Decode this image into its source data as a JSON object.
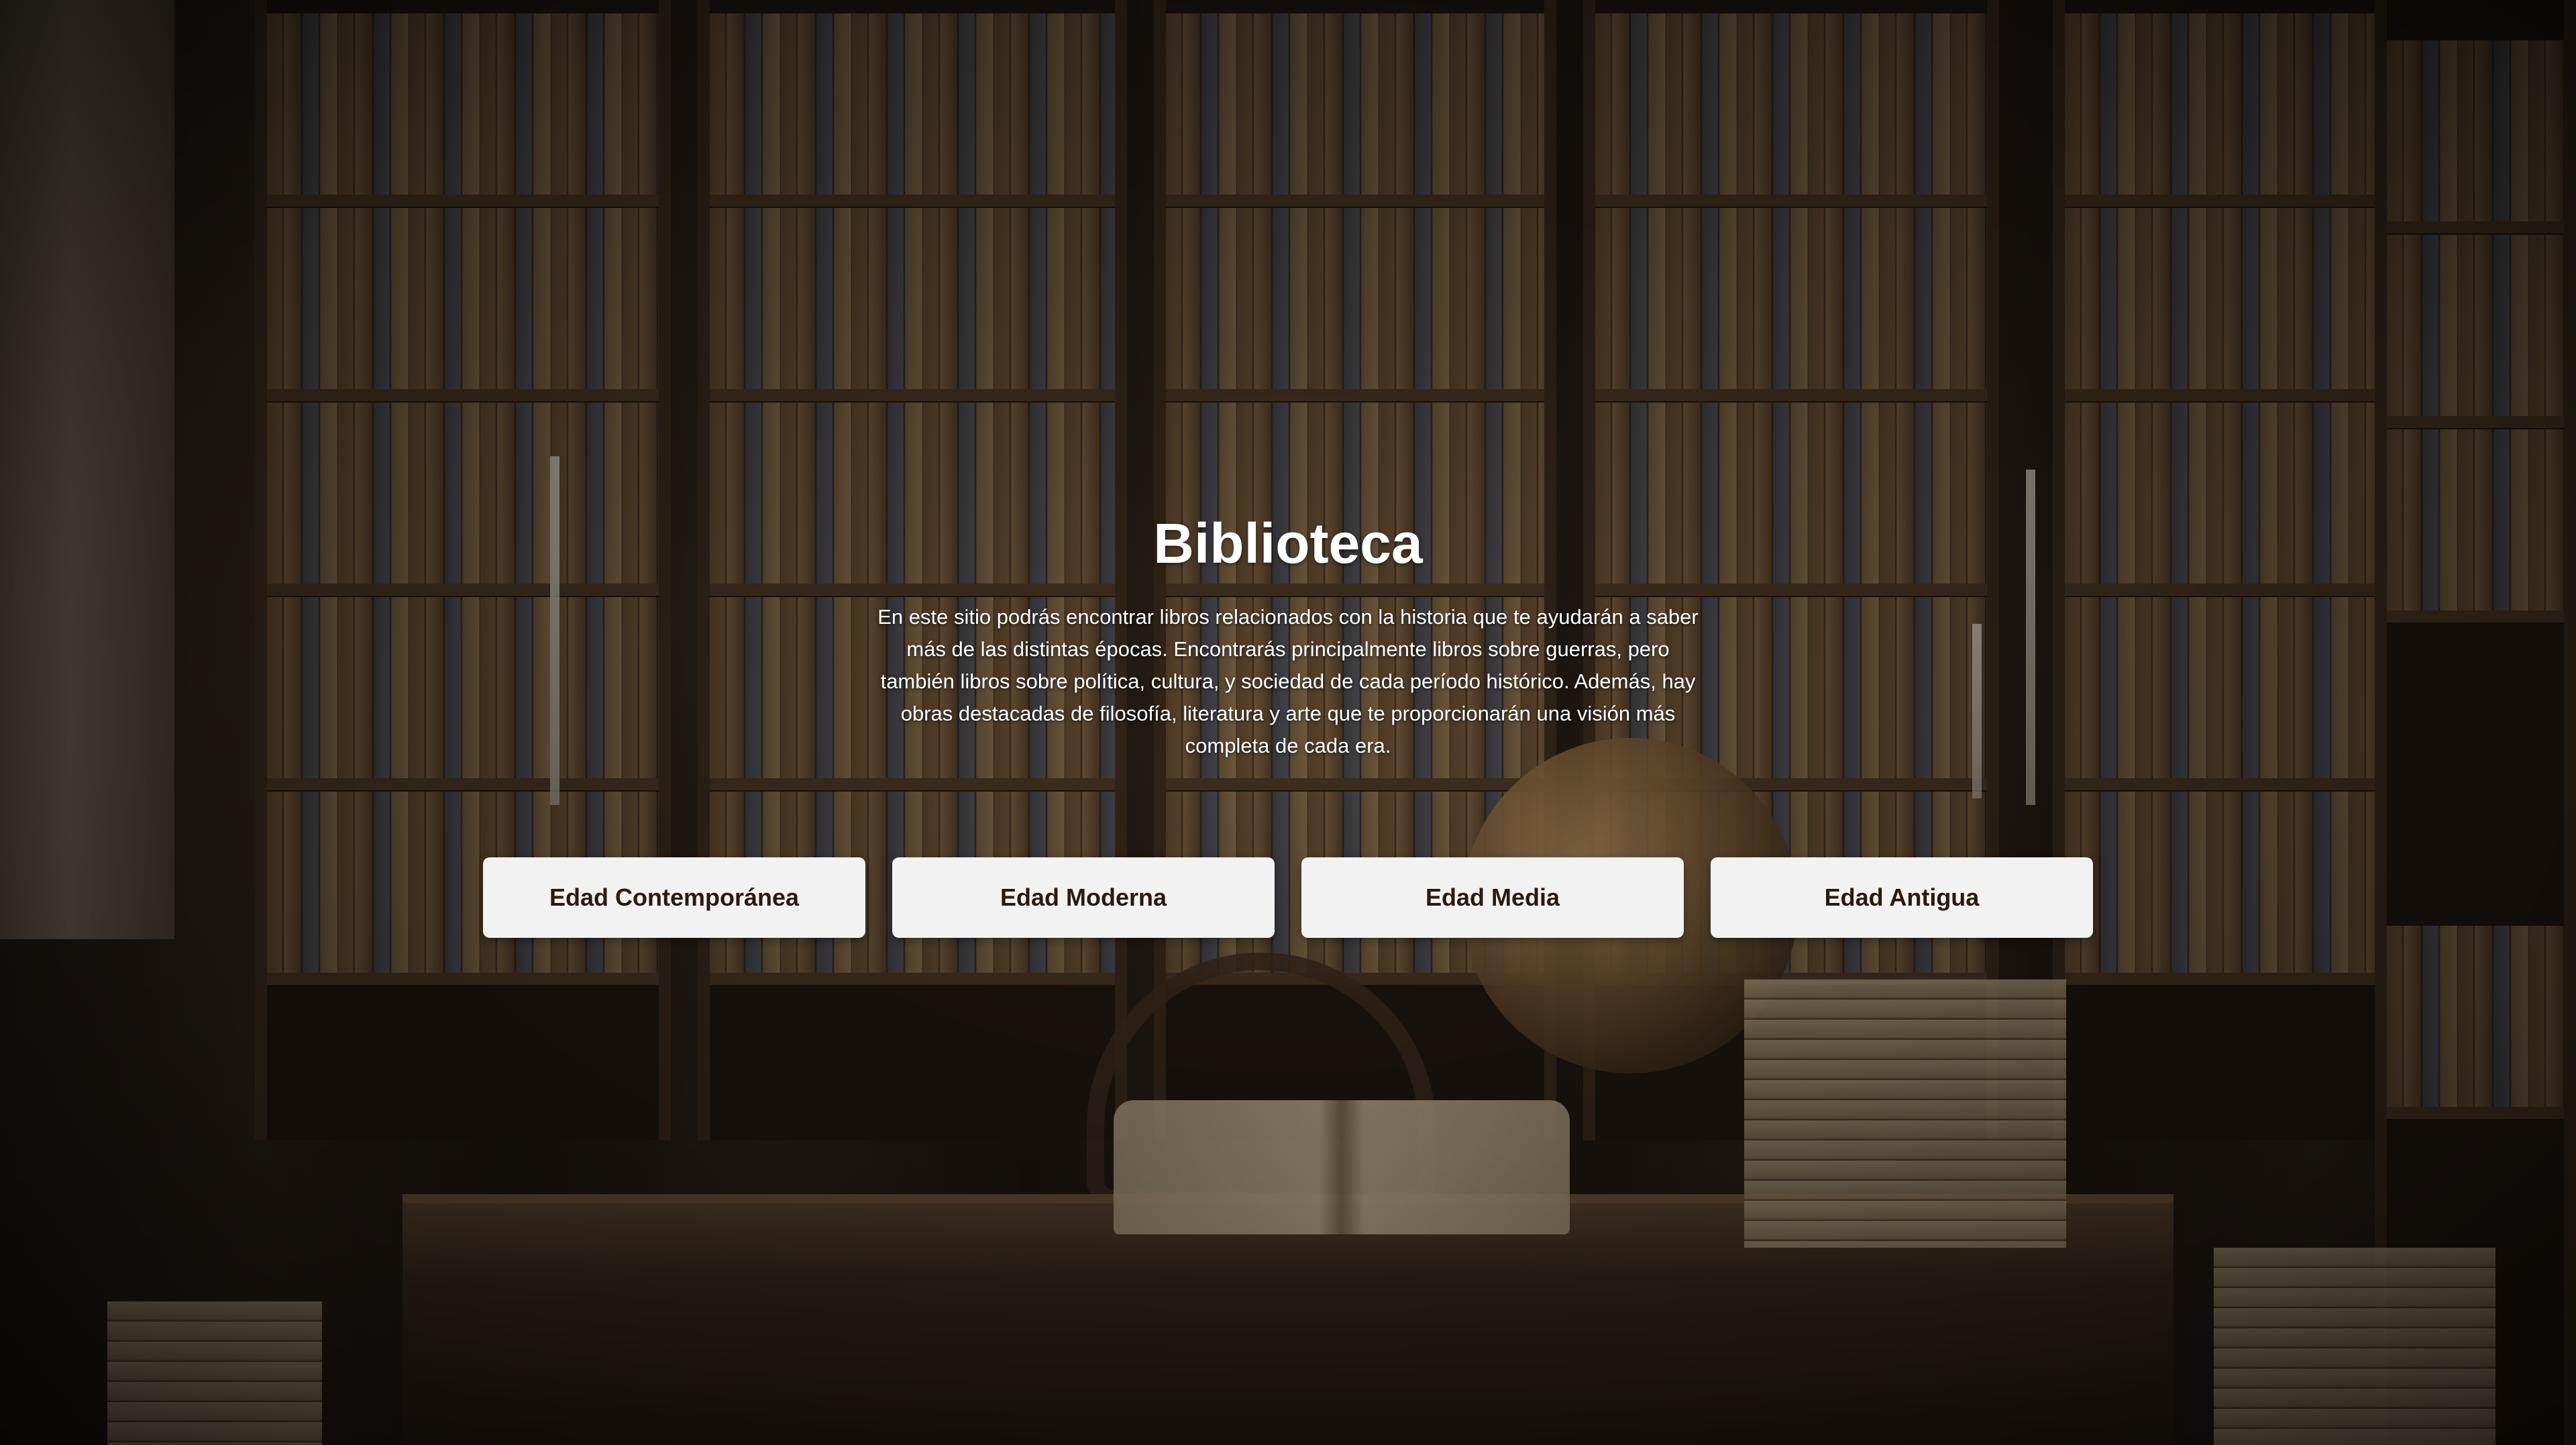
{
  "page": {
    "title": "Biblioteca",
    "description": "En este sitio podrás encontrar libros relacionados con la historia que te ayudarán a saber más de las distintas épocas. Encontrarás principalmente libros sobre guerras, pero también libros sobre política, cultura, y sociedad de cada período histórico. Además, hay obras destacadas de filosofía, literatura y arte que te proporcionarán una visión más completa de cada era.",
    "background_image": "library-bookshelves-scene"
  },
  "buttons": [
    {
      "label": "Edad Contemporánea"
    },
    {
      "label": "Edad Moderna"
    },
    {
      "label": "Edad Media"
    },
    {
      "label": "Edad Antigua"
    }
  ],
  "colors": {
    "button_background": "#f2f2f2",
    "button_text": "#2a1a10",
    "heading_text": "#ffffff"
  }
}
